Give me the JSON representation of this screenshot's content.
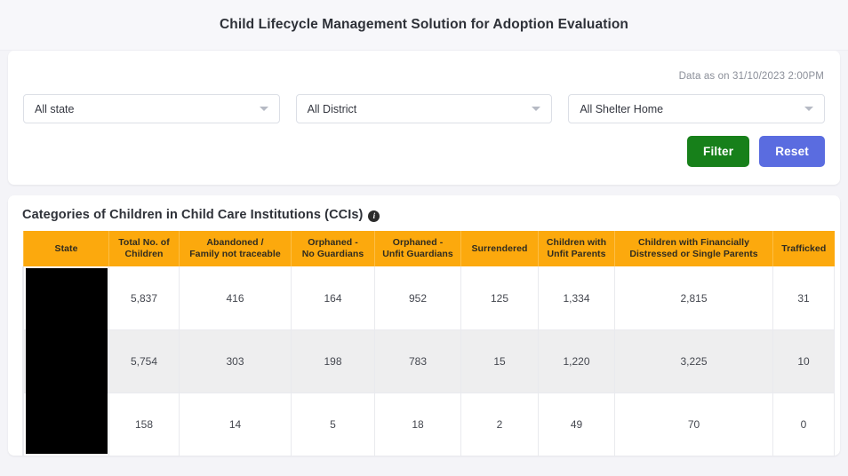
{
  "header": {
    "title": "Child Lifecycle Management Solution for Adoption Evaluation"
  },
  "filters": {
    "data_as_on": "Data as on 31/10/2023 2:00PM",
    "state_select": {
      "value": "All state",
      "caret_icon": "chevron-down-icon"
    },
    "district_select": {
      "value": "All District",
      "caret_icon": "chevron-down-icon"
    },
    "shelter_select": {
      "value": "All Shelter Home",
      "caret_icon": "chevron-down-icon"
    },
    "filter_button": "Filter",
    "reset_button": "Reset",
    "filter_color": "#17801a",
    "reset_color": "#5a6ce0"
  },
  "table_section": {
    "title": "Categories of Children in Child Care Institutions (CCIs)",
    "info_icon": "info-icon",
    "info_glyph": "i",
    "header_color": "#FCA90D",
    "columns": [
      "State",
      "Total No. of Children",
      "Abandoned / Family not traceable",
      "Orphaned - No Guardians",
      "Orphaned - Unfit Guardians",
      "Surrendered",
      "Children with Unfit Parents",
      "Children with Financially Distressed or Single Parents",
      "Trafficked"
    ],
    "columns_lines": [
      [
        "State"
      ],
      [
        "Total No. of",
        "Children"
      ],
      [
        "Abandoned /",
        "Family not traceable"
      ],
      [
        "Orphaned -",
        "No Guardians"
      ],
      [
        "Orphaned -",
        "Unfit Guardians"
      ],
      [
        "Surrendered"
      ],
      [
        "Children with",
        "Unfit Parents"
      ],
      [
        "Children with Financially",
        "Distressed or Single Parents"
      ],
      [
        "Trafficked"
      ]
    ],
    "rows": [
      {
        "state": "",
        "state_redacted": true,
        "total_children": "5,837",
        "abandoned": "416",
        "orphaned_no_guardians": "164",
        "orphaned_unfit_guardians": "952",
        "surrendered": "125",
        "unfit_parents": "1,334",
        "financially_distressed": "2,815",
        "trafficked": "31"
      },
      {
        "state": "",
        "state_redacted": true,
        "total_children": "5,754",
        "abandoned": "303",
        "orphaned_no_guardians": "198",
        "orphaned_unfit_guardians": "783",
        "surrendered": "15",
        "unfit_parents": "1,220",
        "financially_distressed": "3,225",
        "trafficked": "10"
      },
      {
        "state": "",
        "state_redacted": true,
        "total_children": "158",
        "abandoned": "14",
        "orphaned_no_guardians": "5",
        "orphaned_unfit_guardians": "18",
        "surrendered": "2",
        "unfit_parents": "49",
        "financially_distressed": "70",
        "trafficked": "0"
      }
    ]
  }
}
